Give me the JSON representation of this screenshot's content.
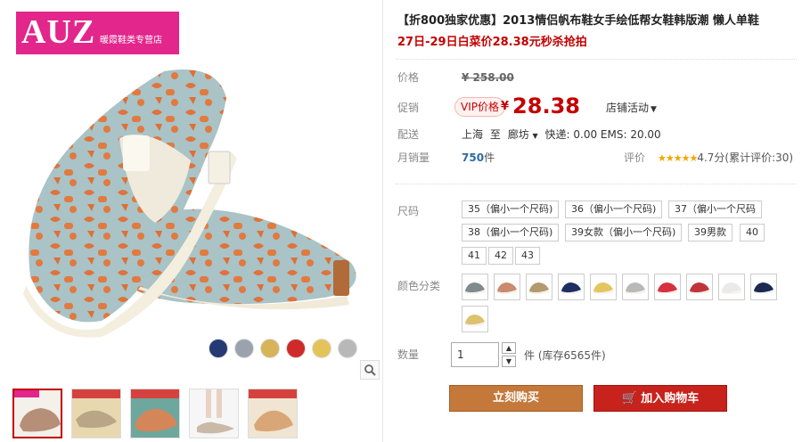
{
  "shop": {
    "logo_text": "AUZ",
    "logo_subtext": "暖霞鞋类专营店"
  },
  "gallery": {
    "swatch_colors": [
      "#253a73",
      "#9aa3ad",
      "#d7b35a",
      "#cf2a2a",
      "#e3c45a",
      "#b8b8b8"
    ],
    "thumbnail_count": 5,
    "zoom_icon": "magnifier-icon"
  },
  "product": {
    "title": "【折800独家优惠】2013情侣帆布鞋女手绘低帮女鞋韩版潮 懒人单鞋",
    "subtitle": "27日-29日白菜价28.38元秒杀抢拍",
    "original_price_label": "价格",
    "original_price": "¥ 258.00",
    "promo_label": "促销",
    "vip_badge": "VIP价格",
    "currency": "¥",
    "promo_price": "28.38",
    "shop_activity": "店铺活动",
    "shipping_label": "配送",
    "ship_from": "上海",
    "ship_to_word": "至",
    "ship_to": "廊坊",
    "shipping_fees": "快递: 0.00 EMS: 20.00",
    "monthly_sales_label": "月销量",
    "monthly_sales": "750",
    "monthly_sales_unit": "件",
    "rating_label": "评价",
    "rating_stars": "★★★★★",
    "rating_text": "4.7分(累计评价:30)"
  },
  "sku": {
    "size_label": "尺码",
    "sizes": [
      "35（偏小一个尺码)",
      "36（偏小一个尺码)",
      "37（偏小一个尺码",
      "38（偏小一个尺码)",
      "39女款（偏小一个尺码)",
      "39男款",
      "40",
      "41",
      "42",
      "43"
    ],
    "color_label": "颜色分类",
    "colors": [
      "#7d8c8f",
      "#c98a6e",
      "#b39a6c",
      "#1f2f63",
      "#e3c65f",
      "#b9b9b9",
      "#d73040",
      "#c0343a",
      "#e9e9e9",
      "#1b2855",
      "#ddc16e"
    ]
  },
  "quantity": {
    "label": "数量",
    "value": "1",
    "unit_stock": "件 (库存6565件)"
  },
  "actions": {
    "buy_now": "立刻购买",
    "add_cart": "加入购物车"
  }
}
